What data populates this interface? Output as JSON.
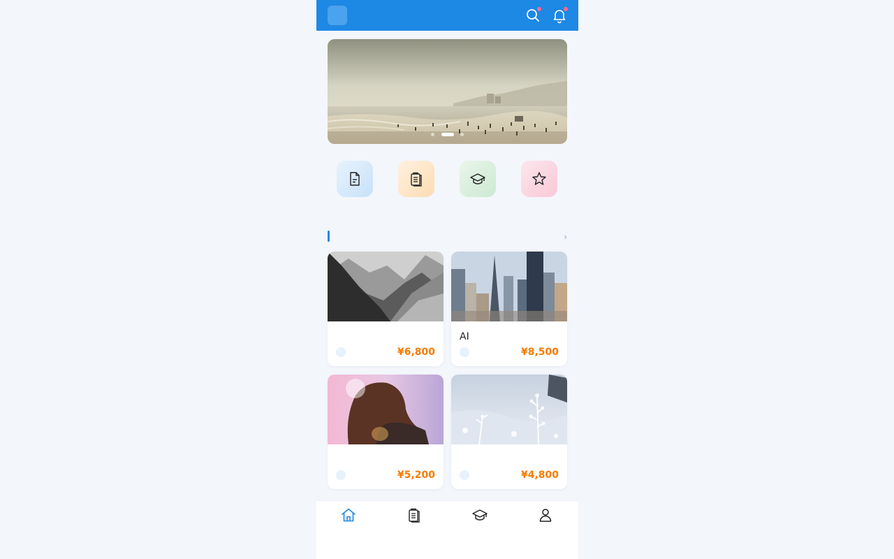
{
  "header": {
    "logo_glyph": "",
    "title": "",
    "search_icon": "search-icon",
    "bell_icon": "bell-icon",
    "badge_color": "#ff6b8b"
  },
  "banner": {
    "scene": "misty-beach-photo",
    "slides": 3,
    "active_slide": 1
  },
  "quick_entries": [
    {
      "label": "",
      "icon": "document-icon",
      "color": "#d6eafb"
    },
    {
      "label": "",
      "icon": "clipboard-icon",
      "color": "#fde7cc"
    },
    {
      "label": "",
      "icon": "graduation-cap-icon",
      "color": "#d9efdd"
    },
    {
      "label": "",
      "icon": "star-icon",
      "color": "#fbd7e2"
    }
  ],
  "section": {
    "title": "",
    "more": "›"
  },
  "cards": [
    {
      "title": "",
      "tag": "",
      "price": "¥6,800",
      "image": "mountain-photo"
    },
    {
      "title": "AI",
      "tag": "",
      "price": "¥8,500",
      "image": "city-photo"
    },
    {
      "title": "",
      "tag": "",
      "price": "¥5,200",
      "image": "portrait-photo"
    },
    {
      "title": "",
      "tag": "",
      "price": "¥4,800",
      "image": "frost-photo"
    }
  ],
  "tabbar": {
    "items": [
      {
        "label": "",
        "icon": "home-icon",
        "active": true
      },
      {
        "label": "",
        "icon": "clipboard-icon",
        "active": false
      },
      {
        "label": "",
        "icon": "graduation-cap-icon",
        "active": false
      },
      {
        "label": "",
        "icon": "user-icon",
        "active": false
      }
    ],
    "accent": "#1e88e5"
  }
}
